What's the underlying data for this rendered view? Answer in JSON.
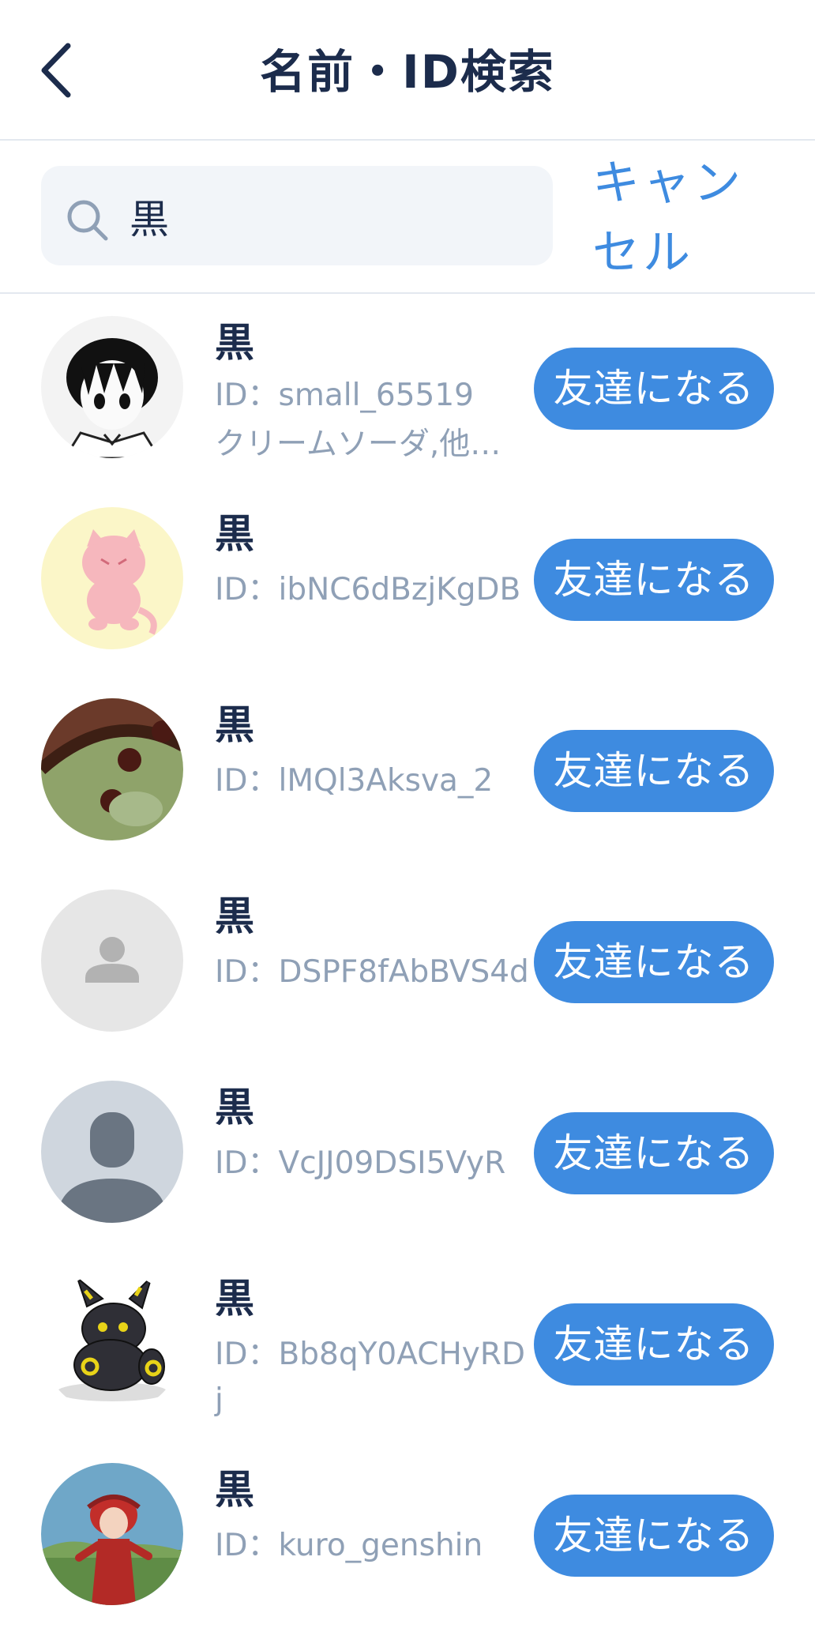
{
  "header": {
    "title": "名前・ID検索"
  },
  "search": {
    "query": "黒",
    "cancel_label": "キャンセル"
  },
  "results": [
    {
      "name": "黒",
      "id": "ID：small_65519",
      "sub": "クリームソーダ,他…",
      "button": "友達になる"
    },
    {
      "name": "黒",
      "id": "ID：ibNC6dBzjKgDB",
      "sub": "",
      "button": "友達になる"
    },
    {
      "name": "黒",
      "id": "ID：lMQl3Aksva_2",
      "sub": "",
      "button": "友達になる"
    },
    {
      "name": "黒",
      "id": "ID：DSPF8fAbBVS4d",
      "sub": "",
      "button": "友達になる"
    },
    {
      "name": "黒",
      "id": "ID：VcJJ09DSI5VyR",
      "sub": "",
      "button": "友達になる"
    },
    {
      "name": "黒",
      "id": "ID：Bb8qY0ACHyRDj",
      "sub": "",
      "button": "友達になる"
    },
    {
      "name": "黒",
      "id": "ID：kuro_genshin",
      "sub": "",
      "button": "友達になる"
    }
  ],
  "colors": {
    "accent": "#3e8be0",
    "title": "#1c2c4c",
    "muted": "#8fa0b6",
    "search_bg": "#f2f5f9"
  },
  "icons": {
    "back": "chevron-left-icon",
    "search": "search-icon"
  }
}
